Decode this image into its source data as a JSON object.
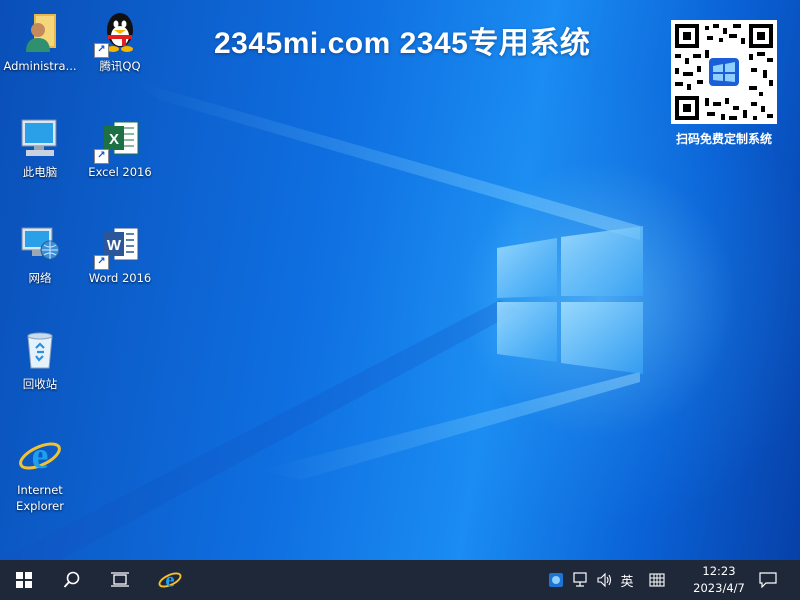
{
  "desktop": {
    "brand_text": "2345mi.com  2345专用系统",
    "qr_caption": "扫码免费定制系统",
    "icons": [
      {
        "name": "icon-administrator",
        "label": "Administra...",
        "icon": "folder-user-icon"
      },
      {
        "name": "icon-qq",
        "label": "腾讯QQ",
        "icon": "qq-penguin-icon"
      },
      {
        "name": "icon-this-pc",
        "label": "此电脑",
        "icon": "computer-icon"
      },
      {
        "name": "icon-excel",
        "label": "Excel 2016",
        "icon": "excel-icon"
      },
      {
        "name": "icon-network",
        "label": "网络",
        "icon": "network-icon"
      },
      {
        "name": "icon-word",
        "label": "Word 2016",
        "icon": "word-icon"
      },
      {
        "name": "icon-recycle-bin",
        "label": "回收站",
        "icon": "recycle-bin-icon"
      },
      {
        "name": "icon-ie",
        "label": "Internet\nExplorer",
        "icon": "internet-explorer-icon"
      }
    ]
  },
  "taskbar": {
    "ime_label": "英",
    "clock_time": "12:23",
    "clock_date": "2023/4/7"
  },
  "colors": {
    "taskbar_bg": "#1f2838",
    "desktop_blue": "#0f6fe0"
  }
}
